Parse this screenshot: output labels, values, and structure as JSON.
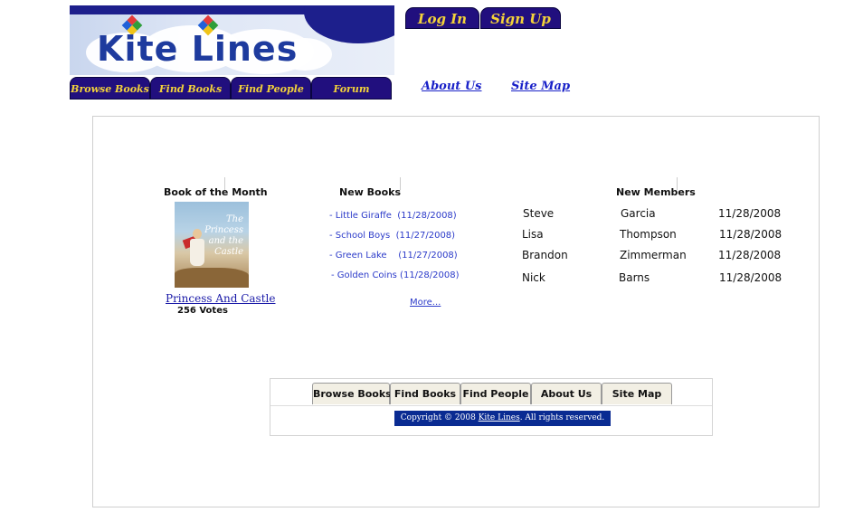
{
  "header": {
    "logo_text": "Kite Lines",
    "login_label": "Log In",
    "signup_label": "Sign Up"
  },
  "nav": {
    "tabs": [
      "Browse Books",
      "Find Books",
      "Find People",
      "Forum"
    ],
    "links": [
      "About Us",
      "Site Map"
    ]
  },
  "book_of_month": {
    "heading": "Book of the Month",
    "cover_title": "The Princess and the Castle",
    "title": "Princess And Castle",
    "votes": "256 Votes"
  },
  "new_books": {
    "heading": "New Books",
    "items": [
      "- Little Giraffe  (11/28/2008)",
      "- School Boys  (11/27/2008)",
      "- Green Lake    (11/27/2008)",
      "- Golden Coins (11/28/2008)"
    ],
    "more_label": "More..."
  },
  "new_members": {
    "heading": "New Members",
    "rows": [
      {
        "first": "Steve",
        "last": "Garcia",
        "date": "11/28/2008"
      },
      {
        "first": "Lisa",
        "last": "Thompson",
        "date": "11/28/2008"
      },
      {
        "first": "Brandon",
        "last": "Zimmerman",
        "date": "11/28/2008"
      },
      {
        "first": "Nick",
        "last": "Barns",
        "date": "11/28/2008"
      }
    ]
  },
  "footer": {
    "tabs": [
      "Browse Books",
      "Find Books",
      "Find People",
      "About Us",
      "Site Map"
    ],
    "copyright_prefix": "Copyright © 2008 ",
    "copyright_link": "Kite Lines",
    "copyright_suffix": ". All rights reserved."
  },
  "colors": {
    "tab_bg": "#210f7e",
    "tab_text": "#f3d23a",
    "link": "#1a22c8",
    "copyright_bg": "#0a2b92"
  }
}
